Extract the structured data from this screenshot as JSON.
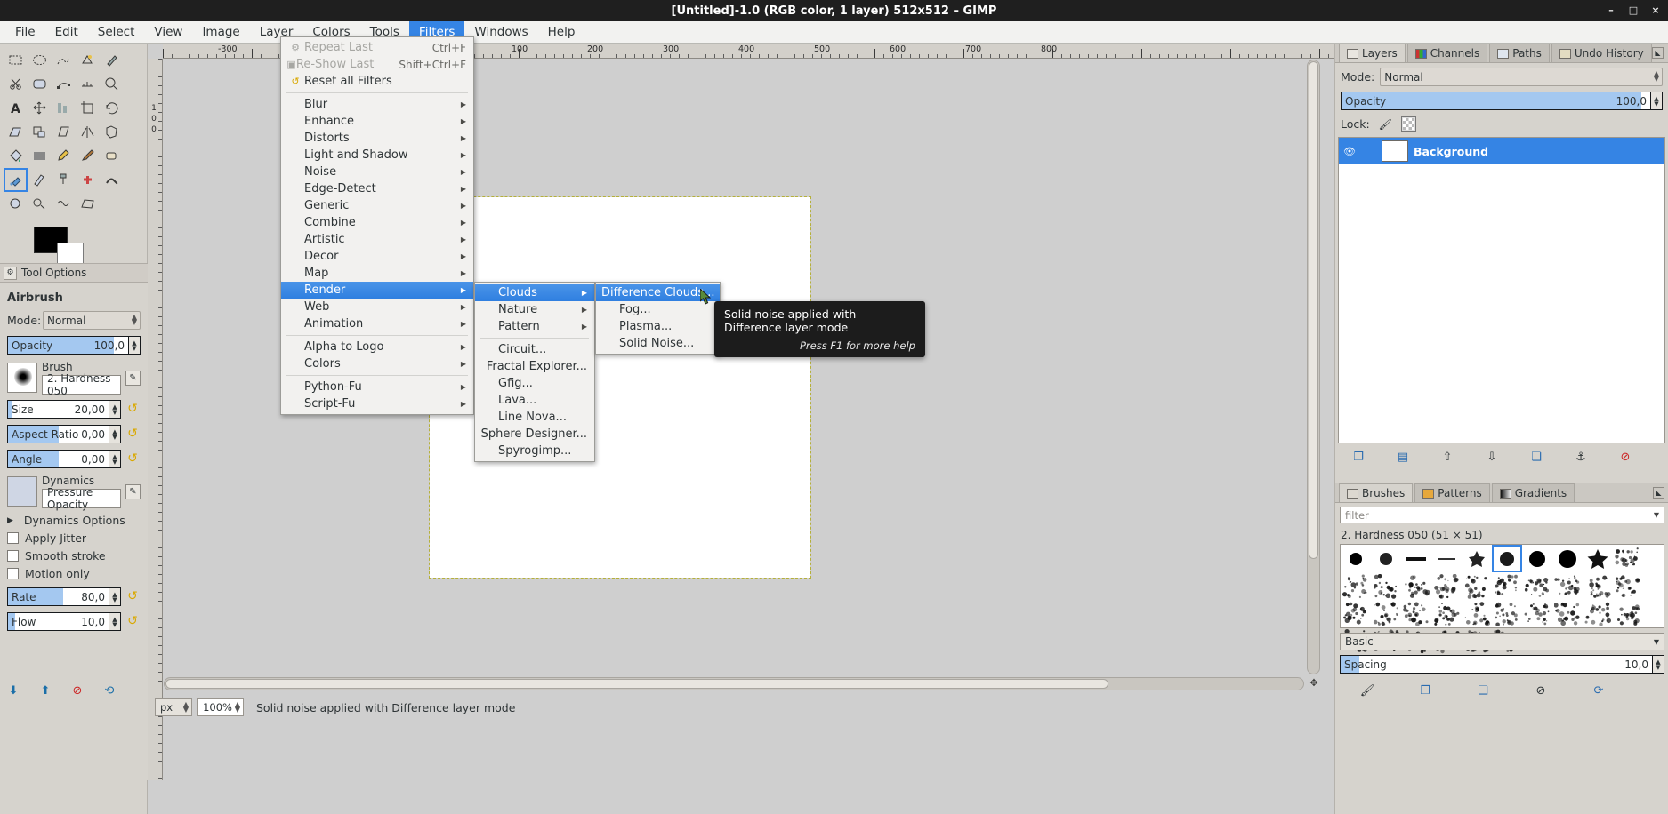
{
  "window": {
    "title": "[Untitled]-1.0 (RGB color, 1 layer) 512x512 – GIMP",
    "minimize": "–",
    "maximize": "□",
    "close": "×"
  },
  "menubar": {
    "items": [
      {
        "label": "File"
      },
      {
        "label": "Edit"
      },
      {
        "label": "Select"
      },
      {
        "label": "View"
      },
      {
        "label": "Image"
      },
      {
        "label": "Layer"
      },
      {
        "label": "Colors"
      },
      {
        "label": "Tools"
      },
      {
        "label": "Filters",
        "active": true
      },
      {
        "label": "Windows"
      },
      {
        "label": "Help"
      }
    ]
  },
  "filters_menu": {
    "repeat_last": "Repeat Last",
    "repeat_last_accel": "Ctrl+F",
    "reshow_last": "Re-Show Last",
    "reshow_last_accel": "Shift+Ctrl+F",
    "reset_all": "Reset all Filters",
    "groups_a": [
      "Blur",
      "Enhance",
      "Distorts",
      "Light and Shadow",
      "Noise",
      "Edge-Detect",
      "Generic",
      "Combine",
      "Artistic",
      "Decor",
      "Map",
      "Render",
      "Web",
      "Animation"
    ],
    "highlighted": "Render",
    "groups_b": [
      "Alpha to Logo",
      "Colors"
    ],
    "groups_c": [
      "Python-Fu",
      "Script-Fu"
    ]
  },
  "render_menu": {
    "items": [
      {
        "label": "Clouds",
        "submenu": true,
        "selected": true
      },
      {
        "label": "Nature",
        "submenu": true
      },
      {
        "label": "Pattern",
        "submenu": true
      },
      {
        "label": "Circuit...",
        "submenu": false
      },
      {
        "label": "Fractal Explorer...",
        "submenu": false
      },
      {
        "label": "Gfig...",
        "submenu": false
      },
      {
        "label": "Lava...",
        "submenu": false
      },
      {
        "label": "Line Nova...",
        "submenu": false
      },
      {
        "label": "Sphere Designer...",
        "submenu": false
      },
      {
        "label": "Spyrogimp...",
        "submenu": false
      }
    ]
  },
  "clouds_menu": {
    "items": [
      {
        "label": "Difference Clouds...",
        "selected": true
      },
      {
        "label": "Fog...",
        "selected": false
      },
      {
        "label": "Plasma...",
        "selected": false
      },
      {
        "label": "Solid Noise...",
        "selected": false
      }
    ]
  },
  "tooltip": {
    "text": "Solid noise applied with Difference layer mode",
    "hint": "Press F1 for more help"
  },
  "toolbox": {
    "icons": [
      "rect-select-icon",
      "ellipse-select-icon",
      "free-select-icon",
      "fuzzy-select-icon",
      "color-picker-icon",
      "scissors-select-icon",
      "foreground-select-icon",
      "paths-icon",
      "measure-icon",
      "zoom-icon",
      "text-icon",
      "move-icon",
      "align-icon",
      "crop-icon",
      "rotate-icon",
      "perspective-clone-icon",
      "scale-icon",
      "shear-icon",
      "flip-icon",
      "cage-transform-icon",
      "bucket-fill-icon",
      "gradient-icon",
      "pencil-icon",
      "paintbrush-icon",
      "eraser-icon",
      "airbrush-icon",
      "ink-icon",
      "clone-icon",
      "heal-icon",
      "smudge-icon",
      "blur-sharpen-icon",
      "dodge-burn-icon",
      "convolve-icon",
      "perspective-icon"
    ],
    "foreground_color": "#000000",
    "background_color": "#ffffff"
  },
  "tool_options": {
    "dock_title": "Tool Options",
    "tool_name": "Airbrush",
    "mode_label": "Mode:",
    "mode_value": "Normal",
    "opacity_label": "Opacity",
    "opacity_value": "100,0",
    "brush_label": "Brush",
    "brush_value": "2. Hardness 050",
    "size_label": "Size",
    "size_value": "20,00",
    "aspect_label": "Aspect Ratio",
    "aspect_value": "0,00",
    "angle_label": "Angle",
    "angle_value": "0,00",
    "dynamics_label": "Dynamics",
    "dynamics_value": "Pressure Opacity",
    "dynamics_options": "Dynamics Options",
    "apply_jitter": "Apply Jitter",
    "smooth_stroke": "Smooth stroke",
    "motion_only": "Motion only",
    "rate_label": "Rate",
    "rate_value": "80,0",
    "flow_label": "Flow",
    "flow_value": "10,0"
  },
  "statusbar": {
    "unit": "px",
    "zoom": "100%",
    "message": "Solid noise applied with Difference layer mode"
  },
  "rulers": {
    "h_labels": [
      "-300",
      "100",
      "200",
      "300",
      "400",
      "500",
      "600",
      "700",
      "800"
    ],
    "v_labels": [
      "1",
      "0",
      "0"
    ]
  },
  "layers_dock": {
    "tabs": [
      {
        "label": "Layers",
        "icon": "layers-icon",
        "selected": true
      },
      {
        "label": "Channels",
        "icon": "channels-icon",
        "selected": false
      },
      {
        "label": "Paths",
        "icon": "paths-icon",
        "selected": false
      },
      {
        "label": "Undo History",
        "icon": "undo-history-icon",
        "selected": false
      }
    ],
    "mode_label": "Mode:",
    "mode_value": "Normal",
    "opacity_label": "Opacity",
    "opacity_value": "100,0",
    "lock_label": "Lock:",
    "layer_name": "Background",
    "tool_icons": [
      "new-layer-icon",
      "new-group-icon",
      "raise-layer-icon",
      "lower-layer-icon",
      "duplicate-layer-icon",
      "anchor-layer-icon",
      "delete-layer-icon"
    ]
  },
  "brushes_dock": {
    "tabs": [
      {
        "label": "Brushes",
        "icon": "brushes-icon",
        "selected": true
      },
      {
        "label": "Patterns",
        "icon": "patterns-icon",
        "selected": false
      },
      {
        "label": "Gradients",
        "icon": "gradients-icon",
        "selected": false
      }
    ],
    "filter_placeholder": "filter",
    "selected_brush": "2. Hardness 050 (51 × 51)",
    "tag_value": "Basic",
    "spacing_label": "Spacing",
    "spacing_value": "10,0",
    "tool_icons": [
      "edit-brush-icon",
      "new-brush-icon",
      "duplicate-brush-icon",
      "delete-brush-icon",
      "refresh-brushes-icon"
    ]
  },
  "colors": {
    "accent": "#3584e4",
    "slider_fill": "#a4c8f0",
    "panel_bg": "#d6d3cd",
    "menu_bg": "#f2f1ef"
  }
}
